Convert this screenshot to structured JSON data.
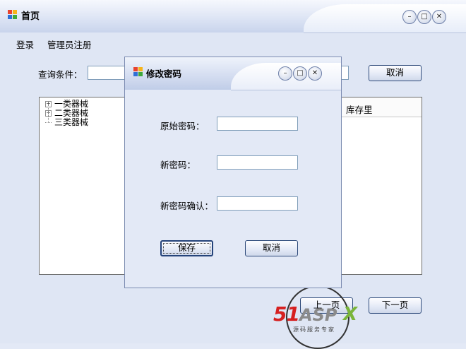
{
  "main_window": {
    "title": "首页",
    "controls": {
      "minimize": "–",
      "maximize": "□",
      "close": "✕"
    }
  },
  "menu": {
    "items": [
      "登录",
      "管理员注册"
    ]
  },
  "search": {
    "label": "查询条件：",
    "value": ""
  },
  "buttons": {
    "cancel": "取消",
    "prev_page": "上一页",
    "next_page": "下一页"
  },
  "tree": {
    "items": [
      {
        "label": "一类器械",
        "expandable": true
      },
      {
        "label": "二类器械",
        "expandable": true
      },
      {
        "label": "三类器械",
        "expandable": false
      }
    ]
  },
  "grid": {
    "columns": [
      "库存里"
    ]
  },
  "dialog": {
    "title": "修改密码",
    "controls": {
      "minimize": "–",
      "maximize": "□",
      "close": "✕"
    },
    "fields": {
      "original_password": {
        "label": "原始密码：",
        "value": ""
      },
      "new_password": {
        "label": "新密码：",
        "value": ""
      },
      "confirm_password": {
        "label": "新密码确认：",
        "value": ""
      }
    },
    "buttons": {
      "save": "保存",
      "cancel": "取消"
    }
  },
  "watermark": {
    "num": "51",
    "brand": "ASP",
    "x": "X",
    "tagline": "源码服务专家"
  },
  "colors": {
    "window_bg": "#dfe6f4",
    "border_dark": "#2e4a7a",
    "watermark_red": "#d62020",
    "watermark_green": "#7ab53a"
  },
  "icons": [
    "app-icon",
    "minimize-icon",
    "maximize-icon",
    "close-icon",
    "tree-expander-icon"
  ]
}
